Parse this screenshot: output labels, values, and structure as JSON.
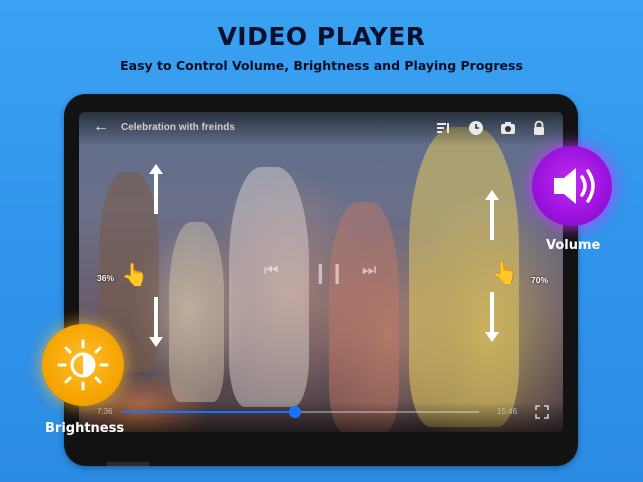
{
  "header": {
    "title": "VIDEO PLAYER",
    "subtitle": "Easy to Control Volume, Brightness and Playing Progress"
  },
  "player": {
    "video_title": "Celebration with freinds",
    "toolbar_icons": [
      "equalizer-icon",
      "timer-icon",
      "camera-icon",
      "lock-icon"
    ],
    "brightness_percent": "36%",
    "volume_percent": "70%",
    "current_time": "7:36",
    "total_time": "15:46",
    "progress": 0.487
  },
  "badges": {
    "volume_label": "Volume",
    "brightness_label": "Brightness"
  },
  "colors": {
    "background": "#2f93ea",
    "accent": "#1a73ff",
    "volume": "#a31ae6",
    "brightness": "#f5a300"
  }
}
